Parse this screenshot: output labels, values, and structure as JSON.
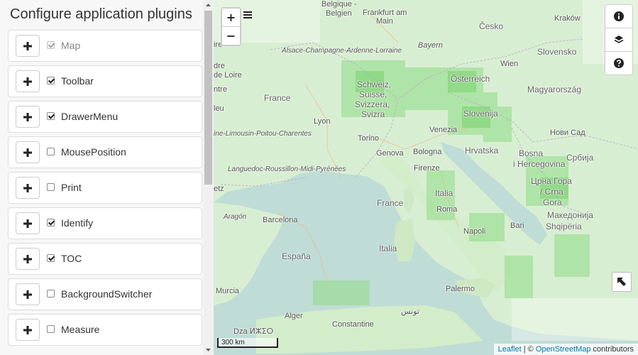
{
  "panel": {
    "title": "Configure application plugins",
    "plugins": [
      {
        "name": "Map",
        "checked": true,
        "disabled": true
      },
      {
        "name": "Toolbar",
        "checked": true,
        "disabled": false
      },
      {
        "name": "DrawerMenu",
        "checked": true,
        "disabled": false
      },
      {
        "name": "MousePosition",
        "checked": false,
        "disabled": false
      },
      {
        "name": "Print",
        "checked": false,
        "disabled": false
      },
      {
        "name": "Identify",
        "checked": true,
        "disabled": false
      },
      {
        "name": "TOC",
        "checked": true,
        "disabled": false
      },
      {
        "name": "BackgroundSwitcher",
        "checked": false,
        "disabled": false
      },
      {
        "name": "Measure",
        "checked": false,
        "disabled": false
      }
    ],
    "add_icon": "plus-icon"
  },
  "map": {
    "zoom_in": "+",
    "zoom_out": "−",
    "drawer_icon": "hamburger-icon",
    "right_controls": [
      "info-icon",
      "layers-icon",
      "help-icon"
    ],
    "background_switcher_icon": "arrow-up-left-icon",
    "scale_label": "300 km",
    "attribution": {
      "leaflet": "Leaflet",
      "separator": " | © ",
      "osm": "OpenStreetMap",
      "suffix": " contributors"
    },
    "labels": {
      "belgique": "Belgique -",
      "belgien": "Belgien",
      "frankfurt": "Frankfurt am",
      "main": "Main",
      "cesko": "Česko",
      "krakow": "Kraków",
      "bayern": "Bayern",
      "slovensko": "Slovensko",
      "alsace": "Alsace-Champagne-Ardenne-Lorraine",
      "wien": "Wien",
      "schweiz": "Schweiz,",
      "suisse": "Suisse,",
      "svizzera": "Svizzera,",
      "svizra": "Svizra",
      "osterreich": "Österreich",
      "magyarorszag": "Magyarország",
      "france": "France",
      "slovenija": "Slovenija",
      "lyon": "Lyon",
      "venezia": "Venezia",
      "novisad": "Нови Сад",
      "torino": "Torino",
      "hrvatska": "Hrvatska",
      "srbija": "Србија",
      "genova": "Genova",
      "bologna": "Bologna",
      "bosna": "Bosna",
      "ihercegovina": "i Hercegovina",
      "poitou": "ine-Limousin-Poitou-Charentes",
      "firenze": "Firenze",
      "languedoc": "Languedoc-Roussillon-Midi-Pyrénées",
      "crnagora1": "Црна Гора",
      "crnagora2": "/ Crna",
      "crnagora3": "Gora",
      "italia1": "Italia",
      "france2": "France",
      "roma": "Roma",
      "aragon": "Aragón",
      "makedonija": "Македонија",
      "barcelona": "Barcelona",
      "shqiperia": "Shqipëria",
      "bari": "Bari",
      "napoli": "Napoli",
      "espana": "España",
      "italia2": "Italia",
      "murcia": "Murcia",
      "palermo": "Palermo",
      "tunis": "تونس",
      "alger": "Alger",
      "constantine": "Constantine",
      "dzayer": "Dza ⵍⵣⵉⵔ",
      "etz": "etz",
      "ire": "ire",
      "de_loire": "de Loire",
      "dre": "dre",
      "ntre": "ntre",
      "leu": "leu"
    }
  }
}
